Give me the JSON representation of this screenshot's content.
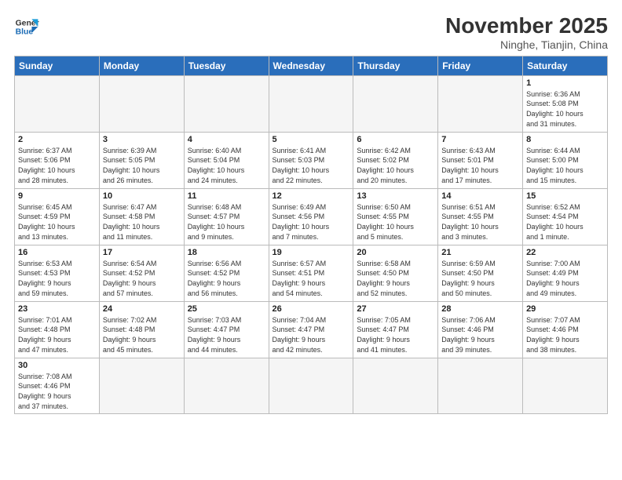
{
  "logo": {
    "line1": "General",
    "line2": "Blue"
  },
  "title": "November 2025",
  "subtitle": "Ninghe, Tianjin, China",
  "weekdays": [
    "Sunday",
    "Monday",
    "Tuesday",
    "Wednesday",
    "Thursday",
    "Friday",
    "Saturday"
  ],
  "weeks": [
    [
      {
        "day": "",
        "info": ""
      },
      {
        "day": "",
        "info": ""
      },
      {
        "day": "",
        "info": ""
      },
      {
        "day": "",
        "info": ""
      },
      {
        "day": "",
        "info": ""
      },
      {
        "day": "",
        "info": ""
      },
      {
        "day": "1",
        "info": "Sunrise: 6:36 AM\nSunset: 5:08 PM\nDaylight: 10 hours\nand 31 minutes."
      }
    ],
    [
      {
        "day": "2",
        "info": "Sunrise: 6:37 AM\nSunset: 5:06 PM\nDaylight: 10 hours\nand 28 minutes."
      },
      {
        "day": "3",
        "info": "Sunrise: 6:39 AM\nSunset: 5:05 PM\nDaylight: 10 hours\nand 26 minutes."
      },
      {
        "day": "4",
        "info": "Sunrise: 6:40 AM\nSunset: 5:04 PM\nDaylight: 10 hours\nand 24 minutes."
      },
      {
        "day": "5",
        "info": "Sunrise: 6:41 AM\nSunset: 5:03 PM\nDaylight: 10 hours\nand 22 minutes."
      },
      {
        "day": "6",
        "info": "Sunrise: 6:42 AM\nSunset: 5:02 PM\nDaylight: 10 hours\nand 20 minutes."
      },
      {
        "day": "7",
        "info": "Sunrise: 6:43 AM\nSunset: 5:01 PM\nDaylight: 10 hours\nand 17 minutes."
      },
      {
        "day": "8",
        "info": "Sunrise: 6:44 AM\nSunset: 5:00 PM\nDaylight: 10 hours\nand 15 minutes."
      }
    ],
    [
      {
        "day": "9",
        "info": "Sunrise: 6:45 AM\nSunset: 4:59 PM\nDaylight: 10 hours\nand 13 minutes."
      },
      {
        "day": "10",
        "info": "Sunrise: 6:47 AM\nSunset: 4:58 PM\nDaylight: 10 hours\nand 11 minutes."
      },
      {
        "day": "11",
        "info": "Sunrise: 6:48 AM\nSunset: 4:57 PM\nDaylight: 10 hours\nand 9 minutes."
      },
      {
        "day": "12",
        "info": "Sunrise: 6:49 AM\nSunset: 4:56 PM\nDaylight: 10 hours\nand 7 minutes."
      },
      {
        "day": "13",
        "info": "Sunrise: 6:50 AM\nSunset: 4:55 PM\nDaylight: 10 hours\nand 5 minutes."
      },
      {
        "day": "14",
        "info": "Sunrise: 6:51 AM\nSunset: 4:55 PM\nDaylight: 10 hours\nand 3 minutes."
      },
      {
        "day": "15",
        "info": "Sunrise: 6:52 AM\nSunset: 4:54 PM\nDaylight: 10 hours\nand 1 minute."
      }
    ],
    [
      {
        "day": "16",
        "info": "Sunrise: 6:53 AM\nSunset: 4:53 PM\nDaylight: 9 hours\nand 59 minutes."
      },
      {
        "day": "17",
        "info": "Sunrise: 6:54 AM\nSunset: 4:52 PM\nDaylight: 9 hours\nand 57 minutes."
      },
      {
        "day": "18",
        "info": "Sunrise: 6:56 AM\nSunset: 4:52 PM\nDaylight: 9 hours\nand 56 minutes."
      },
      {
        "day": "19",
        "info": "Sunrise: 6:57 AM\nSunset: 4:51 PM\nDaylight: 9 hours\nand 54 minutes."
      },
      {
        "day": "20",
        "info": "Sunrise: 6:58 AM\nSunset: 4:50 PM\nDaylight: 9 hours\nand 52 minutes."
      },
      {
        "day": "21",
        "info": "Sunrise: 6:59 AM\nSunset: 4:50 PM\nDaylight: 9 hours\nand 50 minutes."
      },
      {
        "day": "22",
        "info": "Sunrise: 7:00 AM\nSunset: 4:49 PM\nDaylight: 9 hours\nand 49 minutes."
      }
    ],
    [
      {
        "day": "23",
        "info": "Sunrise: 7:01 AM\nSunset: 4:48 PM\nDaylight: 9 hours\nand 47 minutes."
      },
      {
        "day": "24",
        "info": "Sunrise: 7:02 AM\nSunset: 4:48 PM\nDaylight: 9 hours\nand 45 minutes."
      },
      {
        "day": "25",
        "info": "Sunrise: 7:03 AM\nSunset: 4:47 PM\nDaylight: 9 hours\nand 44 minutes."
      },
      {
        "day": "26",
        "info": "Sunrise: 7:04 AM\nSunset: 4:47 PM\nDaylight: 9 hours\nand 42 minutes."
      },
      {
        "day": "27",
        "info": "Sunrise: 7:05 AM\nSunset: 4:47 PM\nDaylight: 9 hours\nand 41 minutes."
      },
      {
        "day": "28",
        "info": "Sunrise: 7:06 AM\nSunset: 4:46 PM\nDaylight: 9 hours\nand 39 minutes."
      },
      {
        "day": "29",
        "info": "Sunrise: 7:07 AM\nSunset: 4:46 PM\nDaylight: 9 hours\nand 38 minutes."
      }
    ],
    [
      {
        "day": "30",
        "info": "Sunrise: 7:08 AM\nSunset: 4:46 PM\nDaylight: 9 hours\nand 37 minutes."
      },
      {
        "day": "",
        "info": ""
      },
      {
        "day": "",
        "info": ""
      },
      {
        "day": "",
        "info": ""
      },
      {
        "day": "",
        "info": ""
      },
      {
        "day": "",
        "info": ""
      },
      {
        "day": "",
        "info": ""
      }
    ]
  ]
}
